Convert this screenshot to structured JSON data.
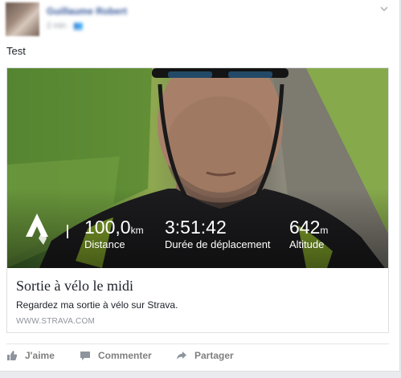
{
  "post": {
    "author": "Guillaume Robert",
    "meta": "2 min · 👥",
    "text": "Test"
  },
  "attachment": {
    "logo_icon": "strava-logo-icon",
    "stats": [
      {
        "value": "100,0",
        "unit": "km",
        "label": "Distance"
      },
      {
        "value": "3:51:42",
        "unit": "",
        "label": "Durée de déplacement"
      },
      {
        "value": "642",
        "unit": "m",
        "label": "Altitude"
      }
    ],
    "title": "Sortie à vélo le midi",
    "description": "Regardez ma sortie à vélo sur Strava.",
    "domain": "WWW.STRAVA.COM"
  },
  "actions": [
    {
      "label": "J'aime",
      "icon": "thumbs-up-icon"
    },
    {
      "label": "Commenter",
      "icon": "comment-icon"
    },
    {
      "label": "Partager",
      "icon": "share-icon"
    }
  ],
  "colors": {
    "link_blue": "#365899",
    "text": "#1d2129",
    "muted": "#90949c",
    "action": "#7f7f7f"
  }
}
